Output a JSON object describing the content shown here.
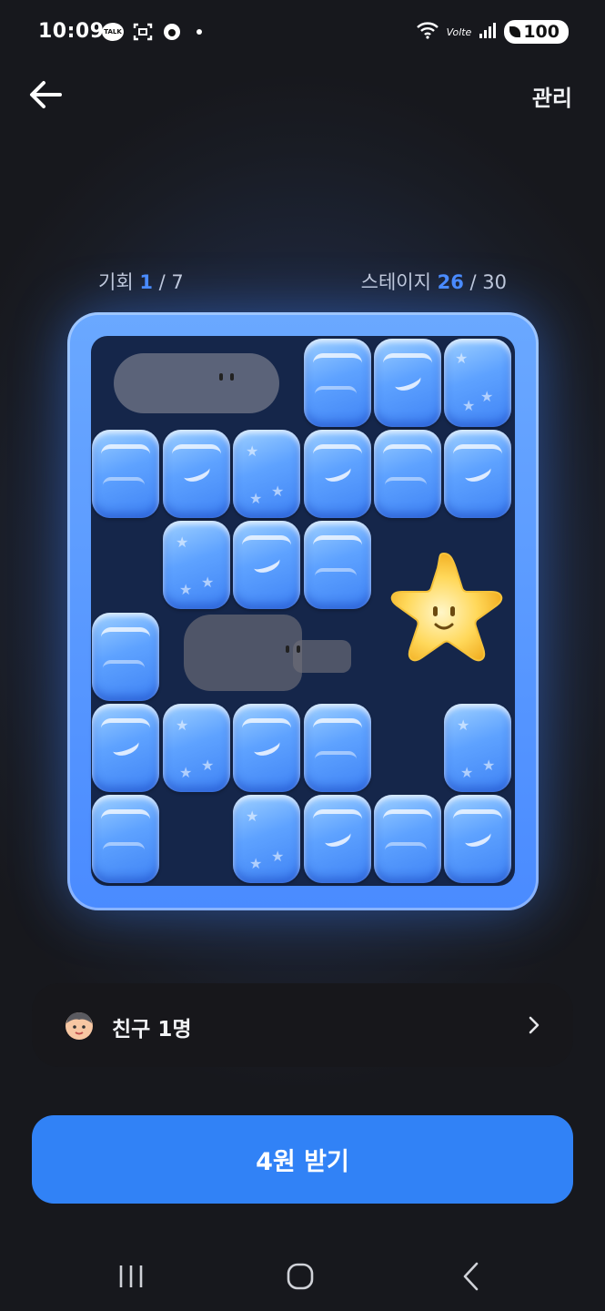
{
  "status_bar": {
    "time": "10:09",
    "talk_badge": "TALK",
    "network": "Volte",
    "battery": "100"
  },
  "header": {
    "manage_label": "관리"
  },
  "game": {
    "chance_label": "기회",
    "chance_current": "1",
    "chance_total": "/ 7",
    "stage_label": "스테이지",
    "stage_current": "26",
    "stage_total": "/ 30",
    "accent_color": "#3182f6"
  },
  "friend": {
    "label": "친구 1명"
  },
  "cta": {
    "label": "4원 받기"
  }
}
